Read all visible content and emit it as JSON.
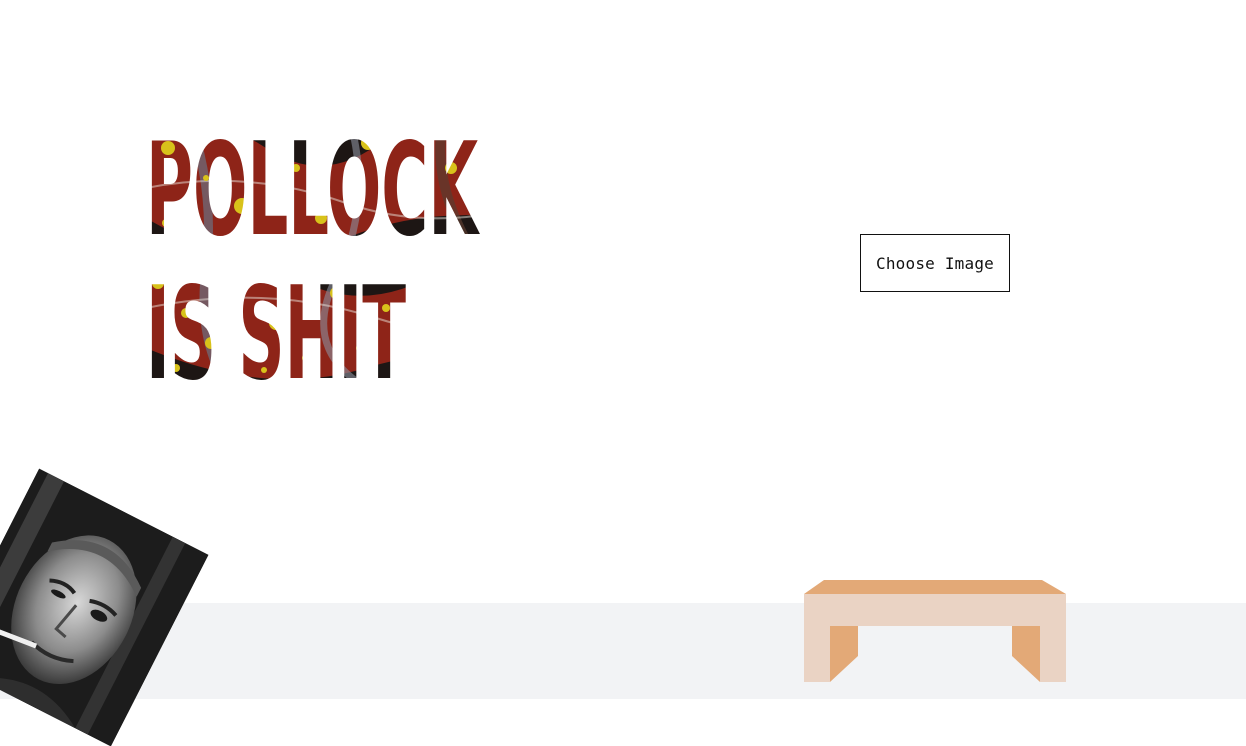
{
  "hero": {
    "line1": "POLLOCK",
    "line2": "IS SHIT"
  },
  "actions": {
    "choose_image_label": "Choose Image"
  },
  "colors": {
    "paint_dark": "#1d1614",
    "paint_red": "#8e2418",
    "paint_yellow": "#d8c21a",
    "bench_light": "#ead3c4",
    "bench_dark": "#e3a977",
    "floor": "#f2f3f5"
  },
  "icons": {
    "portrait": "jackson-pollock-photo",
    "bench": "gallery-bench"
  }
}
